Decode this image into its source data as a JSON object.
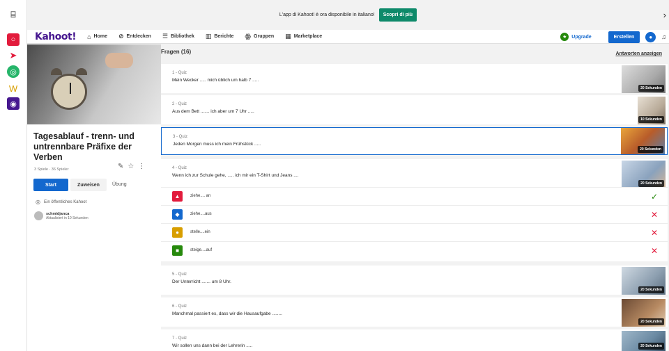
{
  "banner": {
    "text": "L'app di Kahoot! è ora disponibile in italiano!",
    "cta": "Scopri di più"
  },
  "nav": {
    "logo": "Kahoot!",
    "items": [
      {
        "label": "Home",
        "icon": "home-icon"
      },
      {
        "label": "Entdecken",
        "icon": "compass-icon"
      },
      {
        "label": "Bibliothek",
        "icon": "list-icon"
      },
      {
        "label": "Berichte",
        "icon": "bar-chart-icon"
      },
      {
        "label": "Gruppen",
        "icon": "people-icon"
      },
      {
        "label": "Marketplace",
        "icon": "store-icon"
      }
    ],
    "upgrade": "Upgrade",
    "create": "Erstellen"
  },
  "kahoot": {
    "title": "Tagesablauf - trenn- und untrennbare Präfixe der Verben",
    "meta": "3 Spiele · 36 Spieler",
    "start": "Start",
    "assign": "Zuweisen",
    "practice": "Übung",
    "visibility": "Ein öffentliches Kahoot",
    "owner": "schmidjanca",
    "updated": "Aktualisiert in 10 Sekunden"
  },
  "questions_header": "Fragen (16)",
  "show_answers": "Antworten anzeigen",
  "questions": [
    {
      "num": "1 - Quiz",
      "text": "Mein Wecker ..... mich üblich um halb 7 .....",
      "time": "20 Sekunden"
    },
    {
      "num": "2 - Quiz",
      "text": "Aus dem Bett ....... ich aber um 7 Uhr .....",
      "time": "10 Sekunden"
    },
    {
      "num": "3 - Quiz",
      "text": "Jeden Morgen muss ich mein Frühstück .....",
      "time": "20 Sekunden"
    },
    {
      "num": "4 - Quiz",
      "text": "Wenn ich zur Schule gehe, ..... ich mir ein T-Shirt und Jeans ....",
      "time": "20 Sekunden"
    },
    {
      "num": "5 - Quiz",
      "text": "Der Unterricht ....... um 8 Uhr.",
      "time": "20 Sekunden"
    },
    {
      "num": "6 - Quiz",
      "text": "Manchmal passiert es, dass wir die Hausaufgabe ........",
      "time": "20 Sekunden"
    },
    {
      "num": "7 - Quiz",
      "text": "Wir sollen uns dann bei der Lehrerin .....",
      "time": "20 Sekunden"
    }
  ],
  "answers": [
    {
      "text": "ziehe.... an",
      "correct": true,
      "color": "#e21b3c",
      "shape": "triangle"
    },
    {
      "text": "ziehe....aus",
      "correct": false,
      "color": "#1368ce",
      "shape": "diamond"
    },
    {
      "text": "stelle....ein",
      "correct": false,
      "color": "#d89e00",
      "shape": "circle"
    },
    {
      "text": "steige....auf",
      "correct": false,
      "color": "#26890c",
      "shape": "square"
    }
  ],
  "colors": {
    "brand": "#46178f",
    "primary": "#1368ce",
    "correct": "#26890c",
    "wrong": "#e21b3c"
  }
}
